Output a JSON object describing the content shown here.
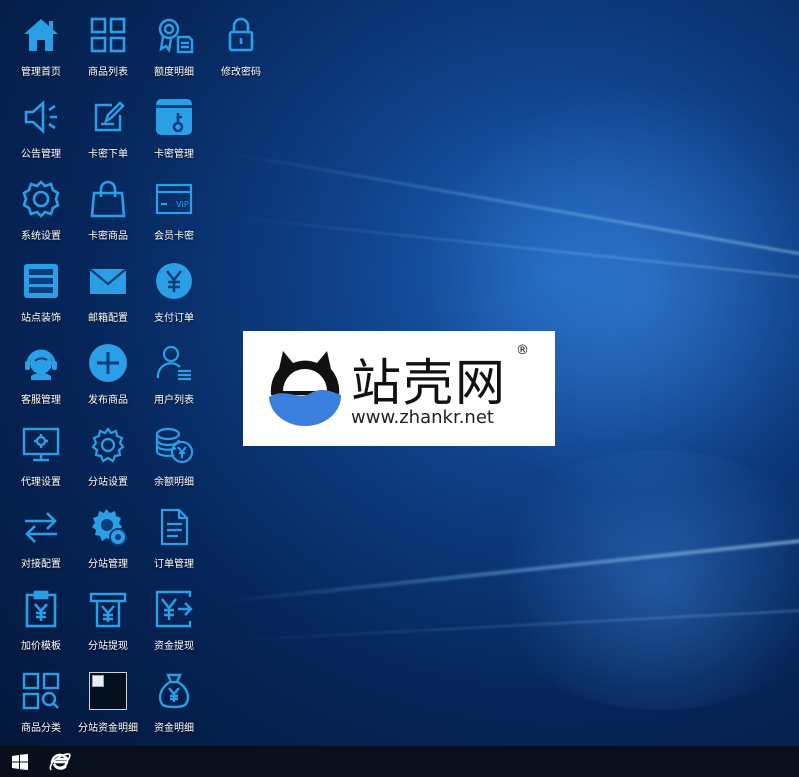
{
  "desktop": {
    "icons": [
      {
        "label": "管理首页",
        "icon": "home-icon"
      },
      {
        "label": "商品列表",
        "icon": "grid-icon"
      },
      {
        "label": "额度明细",
        "icon": "award-doc-icon"
      },
      {
        "label": "修改密码",
        "icon": "lock-icon"
      },
      {
        "label": "公告管理",
        "icon": "speaker-icon"
      },
      {
        "label": "卡密下单",
        "icon": "edit-icon"
      },
      {
        "label": "卡密管理",
        "icon": "card-key-icon"
      },
      {
        "label": "系统设置",
        "icon": "gear-icon"
      },
      {
        "label": "卡密商品",
        "icon": "shopping-bag-icon"
      },
      {
        "label": "会员卡密",
        "icon": "vip-card-icon"
      },
      {
        "label": "站点装饰",
        "icon": "list-panel-icon"
      },
      {
        "label": "邮箱配置",
        "icon": "mail-icon"
      },
      {
        "label": "支付订单",
        "icon": "yen-circle-icon"
      },
      {
        "label": "客服管理",
        "icon": "headset-icon"
      },
      {
        "label": "发布商品",
        "icon": "plus-circle-icon"
      },
      {
        "label": "用户列表",
        "icon": "user-list-icon"
      },
      {
        "label": "代理设置",
        "icon": "monitor-gear-icon"
      },
      {
        "label": "分站设置",
        "icon": "gear-outline-icon"
      },
      {
        "label": "余额明细",
        "icon": "coins-yen-icon"
      },
      {
        "label": "对接配置",
        "icon": "exchange-icon"
      },
      {
        "label": "分站管理",
        "icon": "gears-icon"
      },
      {
        "label": "订单管理",
        "icon": "document-icon"
      },
      {
        "label": "加价模板",
        "icon": "clipboard-yen-icon"
      },
      {
        "label": "分站提现",
        "icon": "atm-yen-icon"
      },
      {
        "label": "资金提现",
        "icon": "yen-transfer-icon"
      },
      {
        "label": "商品分类",
        "icon": "category-search-icon"
      },
      {
        "label": "分站资金明细",
        "icon": "broken-image-icon"
      },
      {
        "label": "资金明细",
        "icon": "money-bag-icon"
      }
    ]
  },
  "watermark": {
    "brand": "站壳网",
    "reg_mark": "®",
    "url": "www.zhankr.net"
  },
  "taskbar": {
    "start_icon": "windows-logo-icon",
    "browser_icon": "internet-explorer-icon"
  },
  "colors": {
    "icon_blue": "#2a9fe6",
    "taskbar": "#0a0e18",
    "watermark_blue": "#3a7fdc"
  }
}
